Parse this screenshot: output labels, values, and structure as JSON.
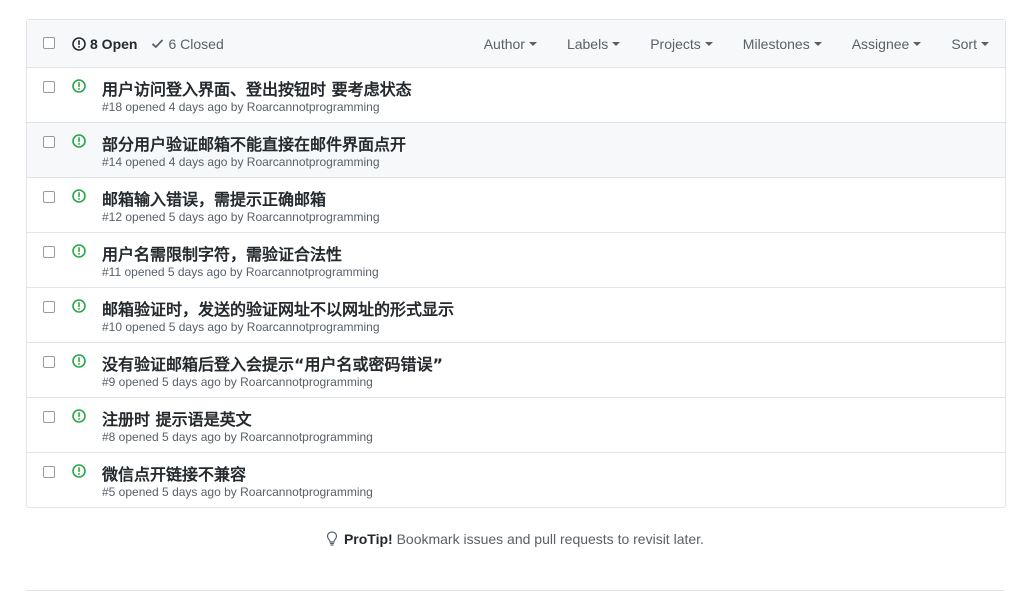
{
  "header": {
    "open_count_label": "8 Open",
    "closed_count_label": "6 Closed",
    "filters": [
      {
        "key": "author",
        "label": "Author"
      },
      {
        "key": "labels",
        "label": "Labels"
      },
      {
        "key": "projects",
        "label": "Projects"
      },
      {
        "key": "milestones",
        "label": "Milestones"
      },
      {
        "key": "assignee",
        "label": "Assignee"
      },
      {
        "key": "sort",
        "label": "Sort"
      }
    ]
  },
  "issues": [
    {
      "title": "用户访问登入界面、登出按钮时 要考虑状态",
      "meta": "#18 opened 4 days ago by Roarcannotprogramming"
    },
    {
      "title": "部分用户验证邮箱不能直接在邮件界面点开",
      "meta": "#14 opened 4 days ago by Roarcannotprogramming"
    },
    {
      "title": "邮箱输入错误，需提示正确邮箱",
      "meta": "#12 opened 5 days ago by Roarcannotprogramming"
    },
    {
      "title": "用户名需限制字符，需验证合法性",
      "meta": "#11 opened 5 days ago by Roarcannotprogramming"
    },
    {
      "title": "邮箱验证时，发送的验证网址不以网址的形式显示",
      "meta": "#10 opened 5 days ago by Roarcannotprogramming"
    },
    {
      "title": "没有验证邮箱后登入会提示“用户名或密码错误”",
      "meta": "#9 opened 5 days ago by Roarcannotprogramming"
    },
    {
      "title": "注册时 提示语是英文",
      "meta": "#8 opened 5 days ago by Roarcannotprogramming"
    },
    {
      "title": "微信点开链接不兼容",
      "meta": "#5 opened 5 days ago by Roarcannotprogramming"
    }
  ],
  "protip": {
    "label": "ProTip!",
    "text": " Bookmark issues and pull requests to revisit later."
  },
  "colors": {
    "open_green": "#28a745",
    "muted": "#586069",
    "border": "#e1e4e8"
  },
  "icons": {
    "open": "issue-opened-icon",
    "closed": "check-icon",
    "protip": "light-bulb-icon"
  }
}
